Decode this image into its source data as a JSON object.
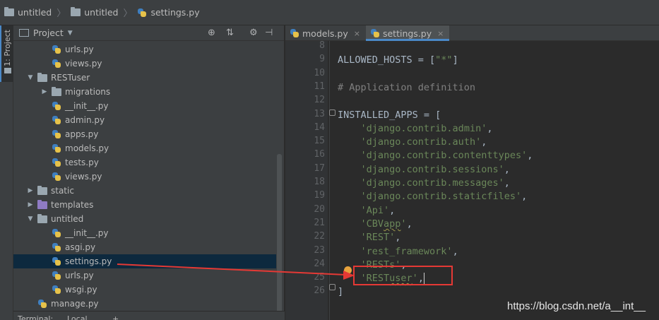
{
  "breadcrumb": {
    "items": [
      "untitled",
      "untitled",
      "settings.py"
    ]
  },
  "left_stripe": {
    "label": "1: Project"
  },
  "project_panel": {
    "title": "Project",
    "tree": [
      {
        "label": "urls.py",
        "type": "py",
        "level": 3,
        "arrow": ""
      },
      {
        "label": "views.py",
        "type": "py",
        "level": 3,
        "arrow": ""
      },
      {
        "label": "RESTuser",
        "type": "folder",
        "level": 2,
        "arrow": "down"
      },
      {
        "label": "migrations",
        "type": "folder",
        "level": 3,
        "arrow": "right"
      },
      {
        "label": "__init__.py",
        "type": "py",
        "level": 3,
        "arrow": ""
      },
      {
        "label": "admin.py",
        "type": "py",
        "level": 3,
        "arrow": ""
      },
      {
        "label": "apps.py",
        "type": "py",
        "level": 3,
        "arrow": ""
      },
      {
        "label": "models.py",
        "type": "py",
        "level": 3,
        "arrow": ""
      },
      {
        "label": "tests.py",
        "type": "py",
        "level": 3,
        "arrow": ""
      },
      {
        "label": "views.py",
        "type": "py",
        "level": 3,
        "arrow": ""
      },
      {
        "label": "static",
        "type": "folder",
        "level": 2,
        "arrow": "right"
      },
      {
        "label": "templates",
        "type": "folder-purple",
        "level": 2,
        "arrow": "right"
      },
      {
        "label": "untitled",
        "type": "folder",
        "level": 2,
        "arrow": "down"
      },
      {
        "label": "__init__.py",
        "type": "py",
        "level": 3,
        "arrow": ""
      },
      {
        "label": "asgi.py",
        "type": "py",
        "level": 3,
        "arrow": ""
      },
      {
        "label": "settings.py",
        "type": "py",
        "level": 3,
        "arrow": "",
        "selected": true
      },
      {
        "label": "urls.py",
        "type": "py",
        "level": 3,
        "arrow": ""
      },
      {
        "label": "wsgi.py",
        "type": "py",
        "level": 3,
        "arrow": ""
      },
      {
        "label": "manage.py",
        "type": "py",
        "level": 2,
        "arrow": ""
      }
    ]
  },
  "bottom_tabs": [
    "Terminal:",
    "Local",
    "+"
  ],
  "editor": {
    "tabs": [
      {
        "label": "models.py",
        "active": false
      },
      {
        "label": "settings.py",
        "active": true
      }
    ],
    "lines": [
      {
        "n": "8",
        "text": ""
      },
      {
        "n": "9",
        "text": "ALLOWED_HOSTS = [\"*\"]"
      },
      {
        "n": "10",
        "text": ""
      },
      {
        "n": "11",
        "text": "# Application definition"
      },
      {
        "n": "12",
        "text": ""
      },
      {
        "n": "13",
        "text": "INSTALLED_APPS = ["
      },
      {
        "n": "14",
        "text": "    'django.contrib.admin',"
      },
      {
        "n": "15",
        "text": "    'django.contrib.auth',"
      },
      {
        "n": "16",
        "text": "    'django.contrib.contenttypes',"
      },
      {
        "n": "17",
        "text": "    'django.contrib.sessions',"
      },
      {
        "n": "18",
        "text": "    'django.contrib.messages',"
      },
      {
        "n": "19",
        "text": "    'django.contrib.staticfiles',"
      },
      {
        "n": "20",
        "text": "    'Api',"
      },
      {
        "n": "21",
        "text": "    'CBVapp',"
      },
      {
        "n": "22",
        "text": "    'REST',"
      },
      {
        "n": "23",
        "text": "    'rest_framework',"
      },
      {
        "n": "24",
        "text": "    'RESTs',"
      },
      {
        "n": "25",
        "text": "    'RESTuser',"
      },
      {
        "n": "26",
        "text": "]"
      }
    ]
  },
  "watermark": "https://blog.csdn.net/a__int__",
  "colors": {
    "string": "#6a8759",
    "comment": "#808080",
    "annotation": "#e53935",
    "selection": "#0d293e"
  }
}
